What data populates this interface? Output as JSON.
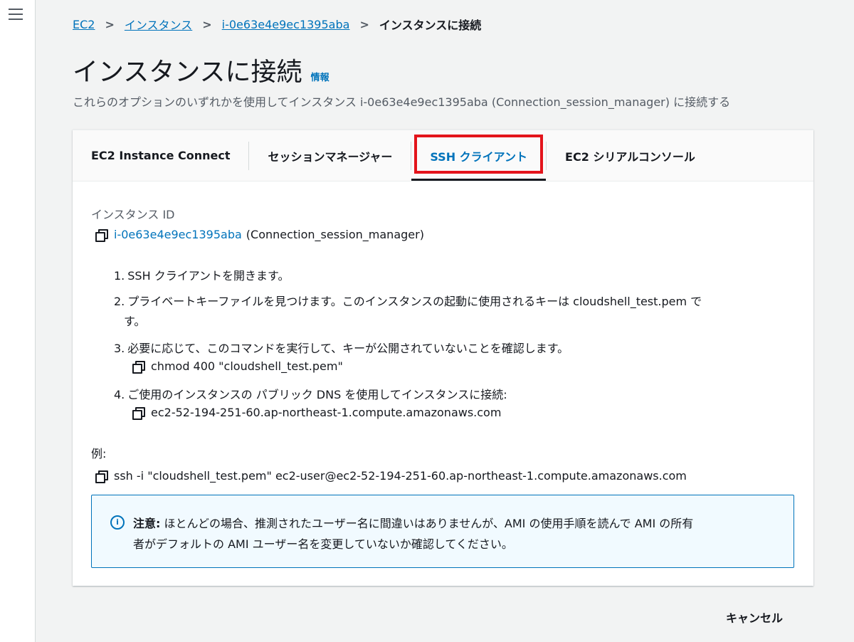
{
  "breadcrumb": {
    "items": [
      "EC2",
      "インスタンス",
      "i-0e63e4e9ec1395aba"
    ],
    "current": "インスタンスに接続",
    "separator": ">"
  },
  "page": {
    "title": "インスタンスに接続",
    "info": "情報",
    "subtitle": "これらのオプションのいずれかを使用してインスタンス i-0e63e4e9ec1395aba (Connection_session_manager) に接続する"
  },
  "tabs": [
    {
      "label": "EC2 Instance Connect"
    },
    {
      "label": "セッションマネージャー"
    },
    {
      "label": "SSH クライアント"
    },
    {
      "label": "EC2 シリアルコンソール"
    }
  ],
  "active_tab": "SSH クライアント",
  "instance": {
    "label": "インスタンス ID",
    "id": "i-0e63e4e9ec1395aba",
    "name": "(Connection_session_manager)"
  },
  "steps": [
    {
      "num": "1.",
      "text": "SSH クライアントを開きます。"
    },
    {
      "num": "2.",
      "text": "プライベートキーファイルを見つけます。このインスタンスの起動に使用されるキーは cloudshell_test.pem で",
      "continuation": "す。"
    },
    {
      "num": "3.",
      "text": "必要に応じて、このコマンドを実行して、キーが公開されていないことを確認します。",
      "command": "chmod 400 \"cloudshell_test.pem\""
    },
    {
      "num": "4.",
      "text": "ご使用のインスタンスの パブリック DNS を使用してインスタンスに接続:",
      "command": "ec2-52-194-251-60.ap-northeast-1.compute.amazonaws.com"
    }
  ],
  "example": {
    "label": "例:",
    "command": "ssh -i \"cloudshell_test.pem\" ec2-user@ec2-52-194-251-60.ap-northeast-1.compute.amazonaws.com"
  },
  "notice": {
    "icon": "info-icon",
    "bold": "注意:",
    "line1": " ほとんどの場合、推測されたユーザー名に間違いはありませんが、AMI の使用手順を読んで AMI の所有",
    "line2": "者がデフォルトの AMI ユーザー名を変更していないか確認してください。"
  },
  "footer": {
    "cancel_label": "キャンセル"
  },
  "colors": {
    "link": "#0073bb",
    "highlight": "#e3141b",
    "notice_bg": "#f1faff"
  }
}
